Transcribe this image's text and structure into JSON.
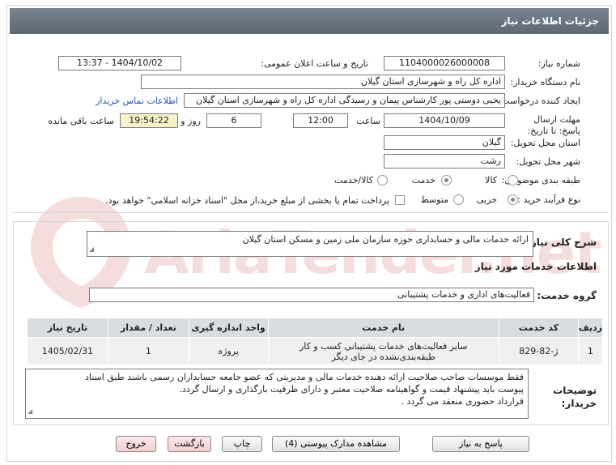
{
  "header": {
    "title": "جزئیات اطلاعات نیاز"
  },
  "watermark": {
    "text": "AriaTender.net"
  },
  "fields": {
    "need_number_label": "شماره نیاز:",
    "need_number": "1104000026000008",
    "announce_label": "تاریخ و ساعت اعلان عمومی:",
    "announce_value": "1404/10/02 - 13:37",
    "buyer_label": "نام دستگاه خریدار:",
    "buyer_value": "اداره کل راه و شهرسازی استان گیلان",
    "creator_label": "ایجاد کننده درخواست:",
    "creator_value": "یحیی دوستی پور کارشناس پیمان و رسیدگی اداره کل راه و شهرسازی استان گیلان",
    "contact_link": "اطلاعات تماس خریدار",
    "deadline_label": "مهلت ارسال پاسخ: تا تاریخ:",
    "deadline_date": "1404/10/09",
    "time_label": "ساعت",
    "deadline_time": "12:00",
    "days_value": "6",
    "days_label": "روز و",
    "remaining_time": "19:54:22",
    "remaining_label": "ساعت باقی مانده",
    "province_label": "استان محل تحویل:",
    "province_value": "گیلان",
    "city_label": "شهر محل تحویل:",
    "city_value": "رشت",
    "category_label": "طبقه بندی موضوعی:",
    "category_options": [
      "کالا",
      "خدمت",
      "کالا/خدمت"
    ],
    "category_selected": "خدمت",
    "process_label": "نوع فرآیند خرید :",
    "process_options": [
      "جزیی",
      "متوسط"
    ],
    "process_selected": "جزیی",
    "payment_note": "پرداخت تمام یا بخشی از مبلغ خرید،از محل \"اسناد خزانه اسلامی\" خواهد بود."
  },
  "description": {
    "label": "شرح کلی نیاز:",
    "value": "ارائه خدمات مالی و حسابداری حوزه سازمان ملی زمین و مسکن استان گیلان"
  },
  "services": {
    "section_title": "اطلاعات خدمات مورد نیاز",
    "group_label": "گروه خدمت:",
    "group_value": "فعالیت‌های اداری و خدمات پشتیبانی",
    "columns": [
      "ردیف",
      "کد خدمت",
      "نام خدمت",
      "واحد اندازه گیری",
      "تعداد / مقدار",
      "تاریخ نیاز"
    ],
    "rows": [
      {
        "index": "1",
        "code": "ژ-82-829",
        "name_line1": "سایر فعالیت‌های خدمات پشتیبانی کسب و کار",
        "name_line2": "طبقه‌بندی‌نشده در جای دیگر",
        "unit": "پروژه",
        "quantity": "1",
        "date": "1405/02/31"
      }
    ]
  },
  "notes": {
    "label": "توضیحات خریدار:",
    "line1": "فقط موسسات صاحب صلاحیت ارائه دهنده خدمات مالی و مدیریتی که عضو جامعه حسابداران رسمی باشند طبق اسناد",
    "line2": "پیوست باید پیشنهاد قیمت و گواهینامه صلاحیت معتبر و دارای ظرفیت بارگذاری و ارسال گردد.",
    "line3": "قرارداد حضوری منعقد می گردد ."
  },
  "buttons": {
    "reply": "پاسخ به نیاز",
    "attachments": "مشاهده مدارک پیوستی (4)",
    "print": "چاپ",
    "back": "بازگشت",
    "exit": "خروج"
  }
}
